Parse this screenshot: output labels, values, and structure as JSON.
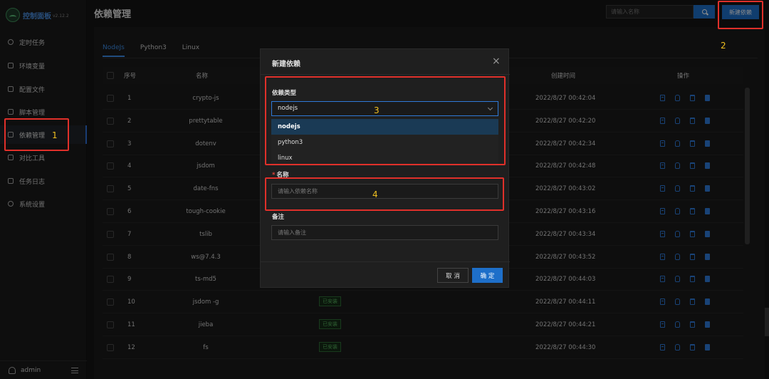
{
  "app": {
    "title": "控制面板",
    "version": "v2.12.2"
  },
  "sidebar": {
    "items": [
      {
        "label": "定时任务"
      },
      {
        "label": "环境变量"
      },
      {
        "label": "配置文件"
      },
      {
        "label": "脚本管理"
      },
      {
        "label": "依赖管理"
      },
      {
        "label": "对比工具"
      },
      {
        "label": "任务日志"
      },
      {
        "label": "系统设置"
      }
    ],
    "active_index": 4,
    "user": "admin"
  },
  "header": {
    "title": "依赖管理",
    "search_placeholder": "请输入名称",
    "new_button": "新建依赖"
  },
  "tabs": [
    {
      "label": "NodeJs",
      "active": true
    },
    {
      "label": "Python3",
      "active": false
    },
    {
      "label": "Linux",
      "active": false
    }
  ],
  "table": {
    "columns": {
      "index": "序号",
      "name": "名称",
      "created": "创建时间",
      "actions": "操作"
    },
    "rows": [
      {
        "index": "1",
        "name": "crypto-js",
        "status": "",
        "created": "2022/8/27 00:42:04"
      },
      {
        "index": "2",
        "name": "prettytable",
        "status": "",
        "created": "2022/8/27 00:42:20"
      },
      {
        "index": "3",
        "name": "dotenv",
        "status": "",
        "created": "2022/8/27 00:42:34"
      },
      {
        "index": "4",
        "name": "jsdom",
        "status": "",
        "created": "2022/8/27 00:42:48"
      },
      {
        "index": "5",
        "name": "date-fns",
        "status": "",
        "created": "2022/8/27 00:43:02"
      },
      {
        "index": "6",
        "name": "tough-cookie",
        "status": "",
        "created": "2022/8/27 00:43:16"
      },
      {
        "index": "7",
        "name": "tslib",
        "status": "",
        "created": "2022/8/27 00:43:34"
      },
      {
        "index": "8",
        "name": "ws@7.4.3",
        "status": "",
        "created": "2022/8/27 00:43:52"
      },
      {
        "index": "9",
        "name": "ts-md5",
        "status": "",
        "created": "2022/8/27 00:44:03"
      },
      {
        "index": "10",
        "name": "jsdom -g",
        "status": "已安装",
        "created": "2022/8/27 00:44:11"
      },
      {
        "index": "11",
        "name": "jieba",
        "status": "已安装",
        "created": "2022/8/27 00:44:21"
      },
      {
        "index": "12",
        "name": "fs",
        "status": "已安装",
        "created": "2022/8/27 00:44:30"
      }
    ]
  },
  "modal": {
    "title": "新建依赖",
    "close": "×",
    "type_label": "依赖类型",
    "type_value": "nodejs",
    "type_options": [
      "nodejs",
      "python3",
      "linux"
    ],
    "required_mark": "*",
    "name_label": "名称",
    "name_placeholder": "请输入依赖名称",
    "remark_label": "备注",
    "remark_placeholder": "请输入备注",
    "cancel": "取 消",
    "ok": "确 定"
  },
  "annotations": [
    "1",
    "2",
    "3",
    "4"
  ],
  "colors": {
    "accent": "#1e6fc9",
    "annotation_box": "#e0302a",
    "annotation_number": "#f0c020",
    "installed": "#58b45f"
  }
}
